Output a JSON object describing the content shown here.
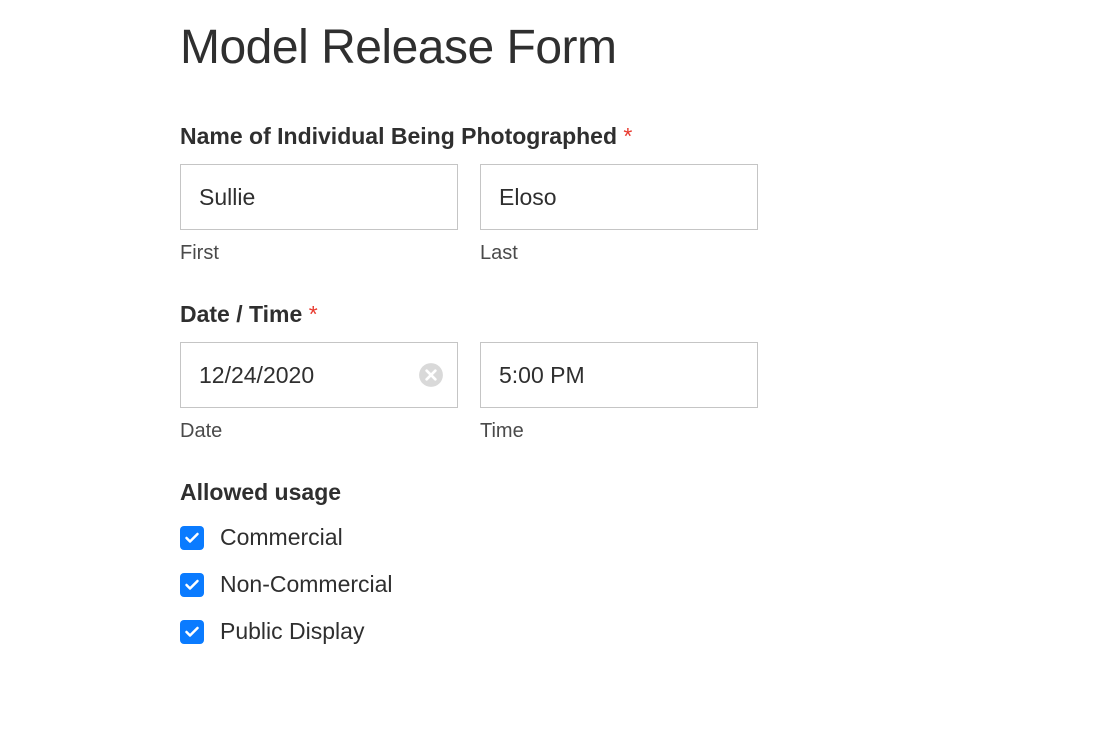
{
  "title": "Model Release Form",
  "name_section": {
    "label": "Name of Individual Being Photographed",
    "required": "*",
    "first_value": "Sullie",
    "first_sublabel": "First",
    "last_value": "Eloso",
    "last_sublabel": "Last"
  },
  "datetime_section": {
    "label": "Date / Time",
    "required": "*",
    "date_value": "12/24/2020",
    "date_sublabel": "Date",
    "time_value": "5:00 PM",
    "time_sublabel": "Time"
  },
  "usage_section": {
    "label": "Allowed usage",
    "options": [
      {
        "label": "Commercial",
        "checked": true
      },
      {
        "label": "Non-Commercial",
        "checked": true
      },
      {
        "label": "Public Display",
        "checked": true
      }
    ]
  }
}
